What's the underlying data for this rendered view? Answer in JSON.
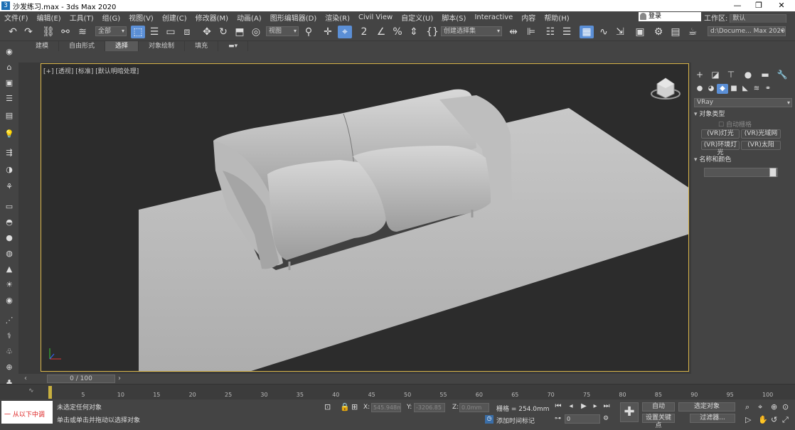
{
  "window": {
    "title": "沙发练习.max - 3ds Max 2020"
  },
  "menu": [
    "文件(F)",
    "编辑(E)",
    "工具(T)",
    "组(G)",
    "视图(V)",
    "创建(C)",
    "修改器(M)",
    "动画(A)",
    "图形编辑器(D)",
    "渲染(R)",
    "Civil View",
    "自定义(U)",
    "脚本(S)",
    "Interactive",
    "内容",
    "帮助(H)"
  ],
  "login": "登录",
  "workspace": {
    "label": "工作区:",
    "value": "默认"
  },
  "toolbar": {
    "filter": "全部",
    "refcoord": "视图",
    "selset": "创建选择集",
    "path": "d:\\Docume... Max 2020"
  },
  "ribbon": [
    "建模",
    "自由形式",
    "选择",
    "对象绘制",
    "填充"
  ],
  "ribbon_selected": "选择",
  "viewport": {
    "label": "[+] [透视] [标准] [默认明暗处理]"
  },
  "command_panel": {
    "renderer": "VRay",
    "rollout_type": "对象类型",
    "autogrid": "自动栅格",
    "buttons": [
      "(VR)灯光",
      "(VR)光域网",
      "(VR)环境灯光",
      "(VR)太阳"
    ],
    "rollout_name": "名称和颜色"
  },
  "timeline": {
    "frame": "0 / 100",
    "ticks": [
      "0",
      "5",
      "10",
      "15",
      "20",
      "25",
      "30",
      "35",
      "40",
      "45",
      "50",
      "55",
      "60",
      "65",
      "70",
      "75",
      "80",
      "85",
      "90",
      "95",
      "100"
    ]
  },
  "status": {
    "maxscript": "一  从以下中调",
    "line1": "未选定任何对象",
    "line2": "单击或单击并拖动以选择对象",
    "x_label": "X:",
    "x": "545.948m",
    "y_label": "Y:",
    "y": "-3206.85",
    "z_label": "Z:",
    "z": "0.0mm",
    "grid": "栅格 = 254.0mm",
    "add_marker": "添加时间标记",
    "auto": "自动",
    "selected": "选定对象",
    "set_key": "设置关键点",
    "filters": "过滤器...",
    "frame_field": "0"
  }
}
